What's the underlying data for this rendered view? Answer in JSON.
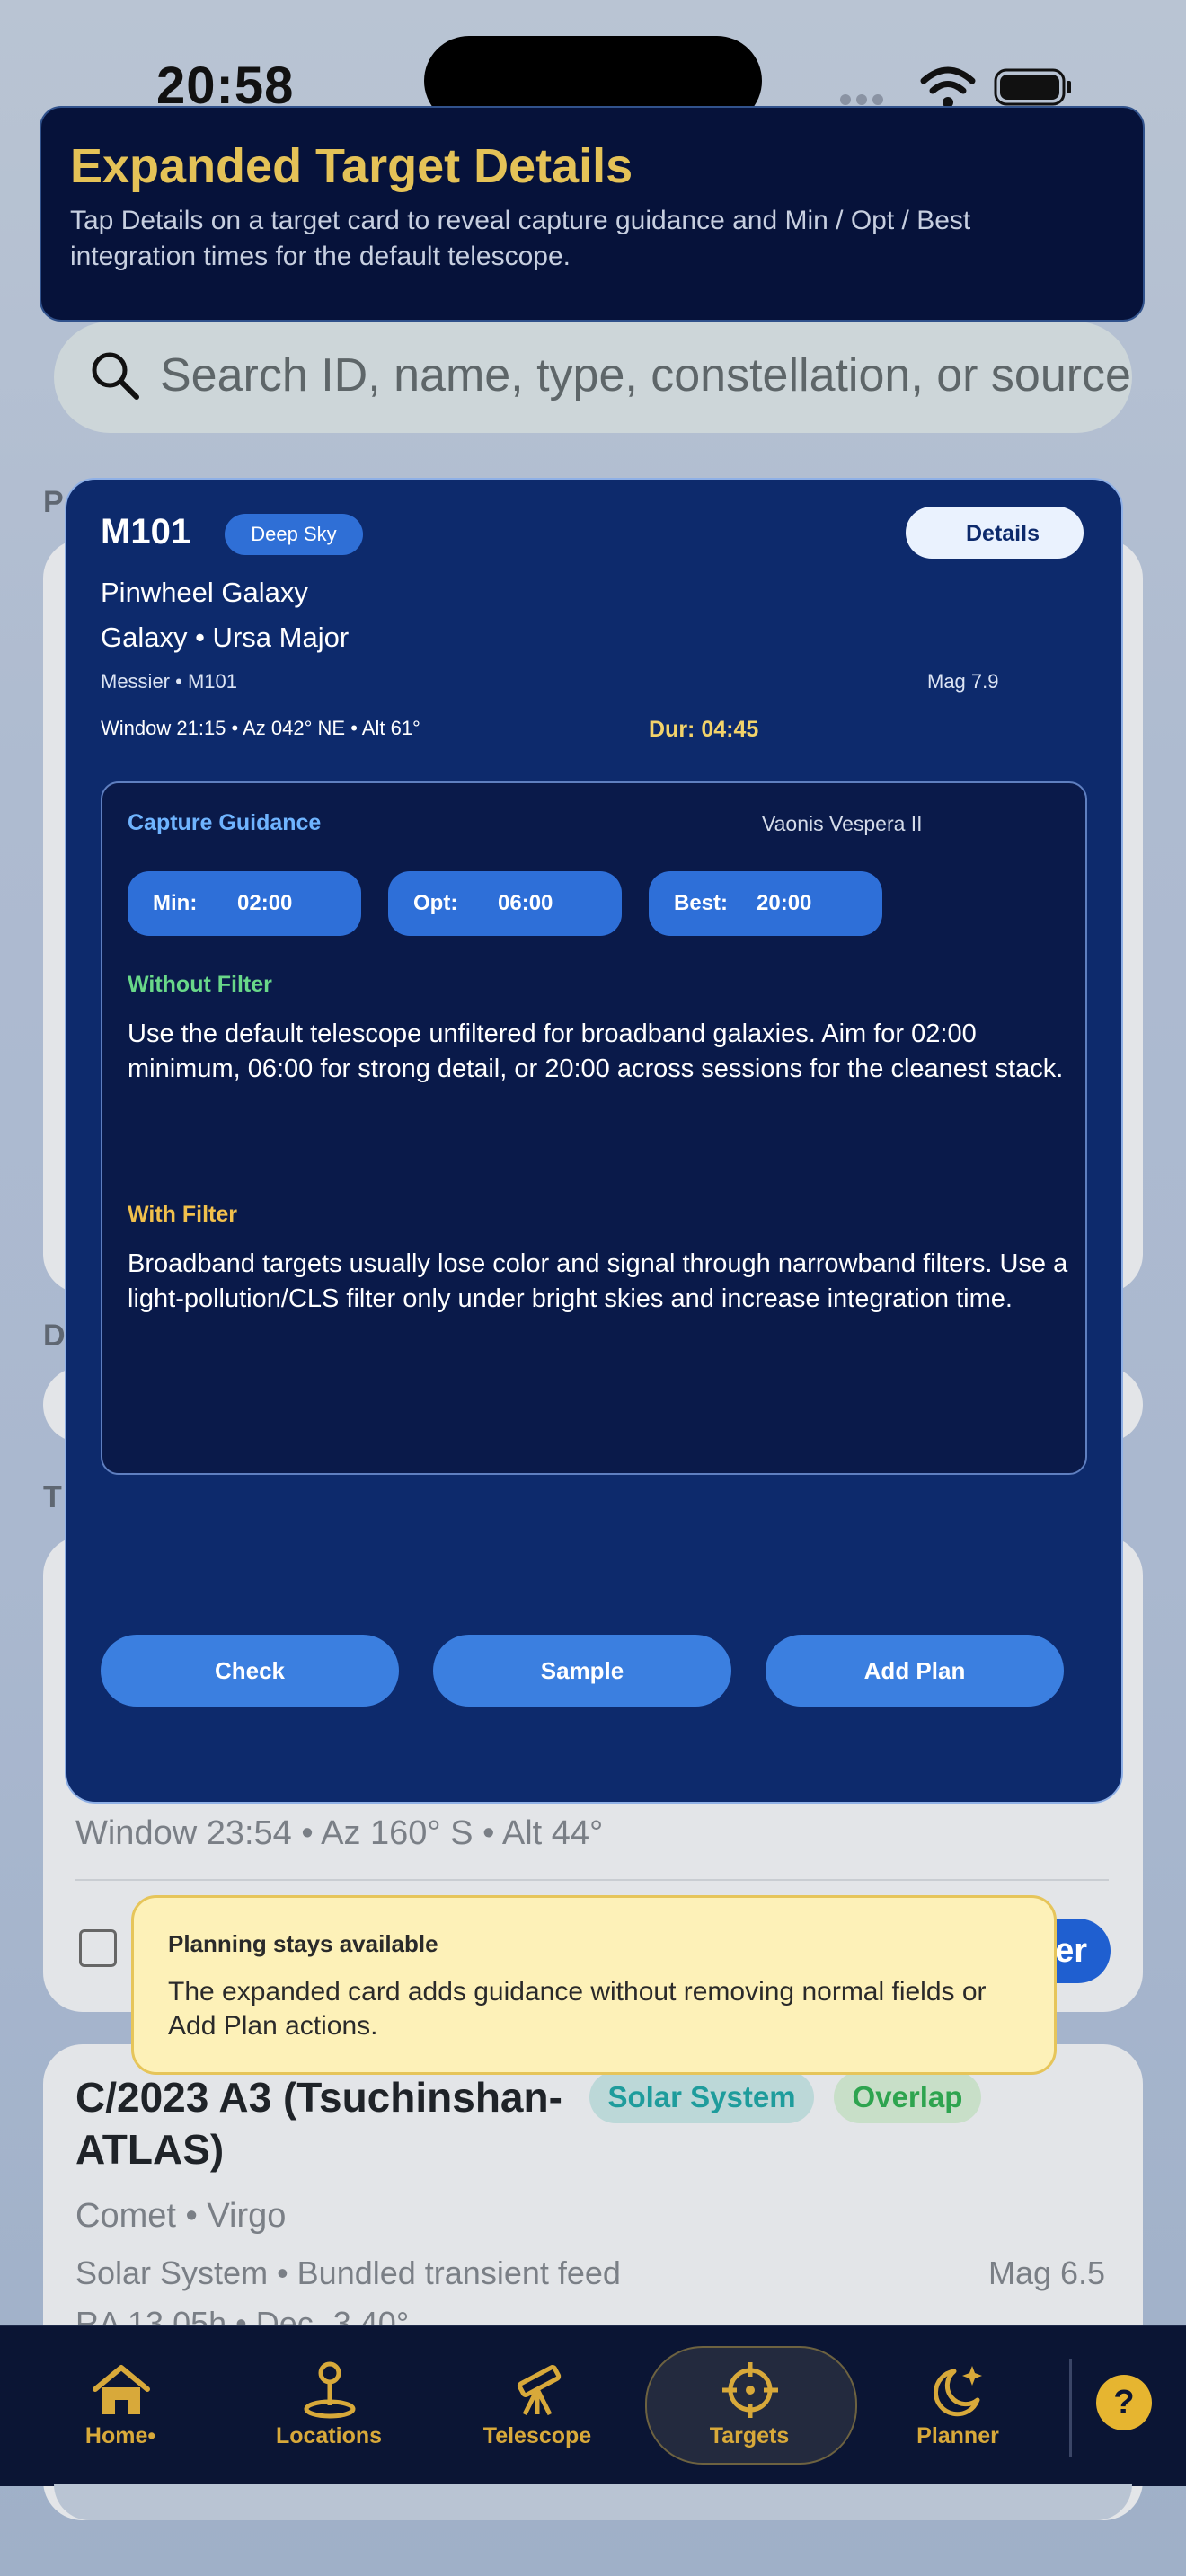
{
  "status_bar": {
    "time": "20:58"
  },
  "banner": {
    "title": "Expanded Target Details",
    "text": "Tap Details on a target card to reveal capture guidance and Min / Opt / Best integration times for the default telescope."
  },
  "search": {
    "placeholder": "Search ID, name, type, constellation, or source"
  },
  "background_sections": {
    "letter1": "P",
    "letter2": "D",
    "letter3": "T"
  },
  "target_card": {
    "id": "M101",
    "badge": "Deep Sky",
    "details_label": "Details",
    "name": "Pinwheel Galaxy",
    "type_line": "Galaxy • Ursa Major",
    "catalog": "Messier • M101",
    "magnitude": "Mag 7.9",
    "window": "Window 21:15 • Az 042° NE • Alt 61°",
    "duration": "Dur: 04:45",
    "guidance": {
      "title": "Capture Guidance",
      "telescope": "Vaonis Vespera II",
      "min_label": "Min:",
      "min_value": "02:00",
      "opt_label": "Opt:",
      "opt_value": "06:00",
      "best_label": "Best:",
      "best_value": "20:00",
      "without_filter_title": "Without Filter",
      "without_filter_text": "Use the default telescope unfiltered for broadband galaxies. Aim for 02:00 minimum, 06:00 for strong detail, or 20:00 across sessions for the cleanest stack.",
      "with_filter_title": "With Filter",
      "with_filter_text": "Broadband targets usually lose color and signal through narrowband filters. Use a light-pollution/CLS filter only under bright skies and increase integration time."
    },
    "actions": {
      "check": "Check",
      "sample": "Sample",
      "add_plan": "Add Plan"
    }
  },
  "background_card": {
    "window": "Window 23:54 • Az 160° S • Alt 44°",
    "button_fragment": "er"
  },
  "tooltip": {
    "title": "Planning stays available",
    "text": "The expanded card adds guidance without removing normal fields or Add Plan actions."
  },
  "comet_card": {
    "title": "C/2023 A3 (Tsuchinshan-ATLAS)",
    "badge_system": "Solar System",
    "badge_overlap": "Overlap",
    "type_line": "Comet • Virgo",
    "source": "Solar System • Bundled transient feed",
    "magnitude": "Mag 6.5",
    "coords": "RA 13.05h • Dec -3.40°"
  },
  "tab_bar": {
    "tabs": [
      {
        "label": "Home•",
        "icon": "home-icon"
      },
      {
        "label": "Locations",
        "icon": "location-pin-icon"
      },
      {
        "label": "Telescope",
        "icon": "telescope-icon"
      },
      {
        "label": "Targets",
        "icon": "crosshair-icon",
        "selected": true
      },
      {
        "label": "Planner",
        "icon": "moon-stars-icon"
      }
    ],
    "help": "?"
  },
  "colors": {
    "accent_gold": "#e4c257",
    "card_blue": "#0d2a6c",
    "button_blue": "#3b7fe0",
    "tab_gold": "#d8a93a"
  }
}
